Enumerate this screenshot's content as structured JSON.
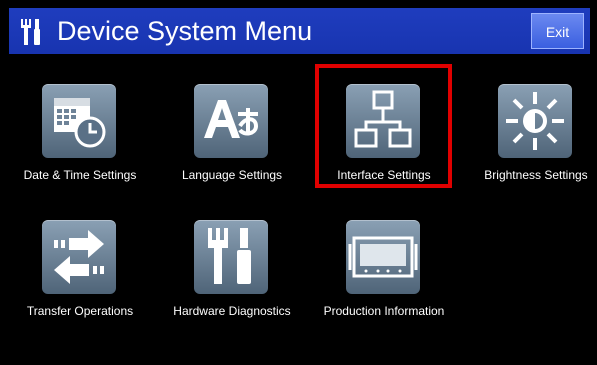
{
  "header": {
    "title": "Device System Menu",
    "exit_label": "Exit"
  },
  "colors": {
    "title_bar": "#1f3dbe",
    "exit_button": "#4f72ea",
    "tile_icon": "#6e8398",
    "selection": "#e00000"
  },
  "menu": {
    "items": [
      {
        "label": "Date & Time Settings",
        "icon": "calendar-clock-icon"
      },
      {
        "label": "Language Settings",
        "icon": "language-icon"
      },
      {
        "label": "Interface Settings",
        "icon": "network-icon",
        "selected": true
      },
      {
        "label": "Brightness Settings",
        "icon": "brightness-icon"
      },
      {
        "label": "Transfer Operations",
        "icon": "transfer-arrows-icon"
      },
      {
        "label": "Hardware Diagnostics",
        "icon": "tools-icon"
      },
      {
        "label": "Production Information",
        "icon": "device-screen-icon"
      }
    ]
  }
}
